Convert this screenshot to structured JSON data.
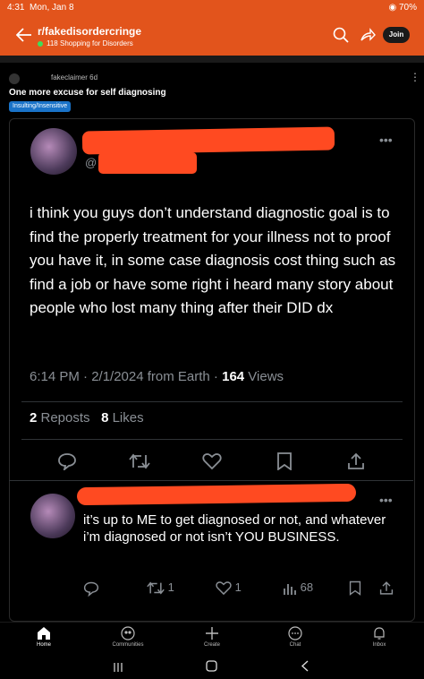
{
  "status": {
    "time": "4:31",
    "date": "Mon, Jan 8",
    "battery": "70%"
  },
  "header": {
    "subreddit": "r/fakedisordercringe",
    "online": "118 Shopping for Disorders",
    "join_label": "Join"
  },
  "post": {
    "author": "fakeclaimer",
    "age": "6d",
    "title": "One more excuse for self diagnosing",
    "flair": "Insulting/Insensitive"
  },
  "tweet": {
    "handle_prefix": "@",
    "body": "i think you guys don’t understand diagnostic goal is to find the properly treatment for your illness not to proof you have it, in some case diagnosis cost thing such as find a job or have some right i heard many story about people who lost many thing after their DID dx",
    "meta_time": "6:14 PM · 2/1/2024 from Earth · ",
    "views_count": "164",
    "views_label": " Views",
    "reposts_count": "2",
    "reposts_label": " Reposts",
    "likes_count": "8",
    "likes_label": " Likes"
  },
  "reply": {
    "body": "it’s up to ME to get diagnosed or not, and whatever i’m diagnosed or not isn’t YOU BUSINESS.",
    "retweets": "1",
    "likes": "1",
    "views": "68"
  },
  "bottom_nav": {
    "home": "Home",
    "communities": "Communities",
    "create": "Create",
    "chat": "Chat",
    "inbox": "Inbox"
  }
}
